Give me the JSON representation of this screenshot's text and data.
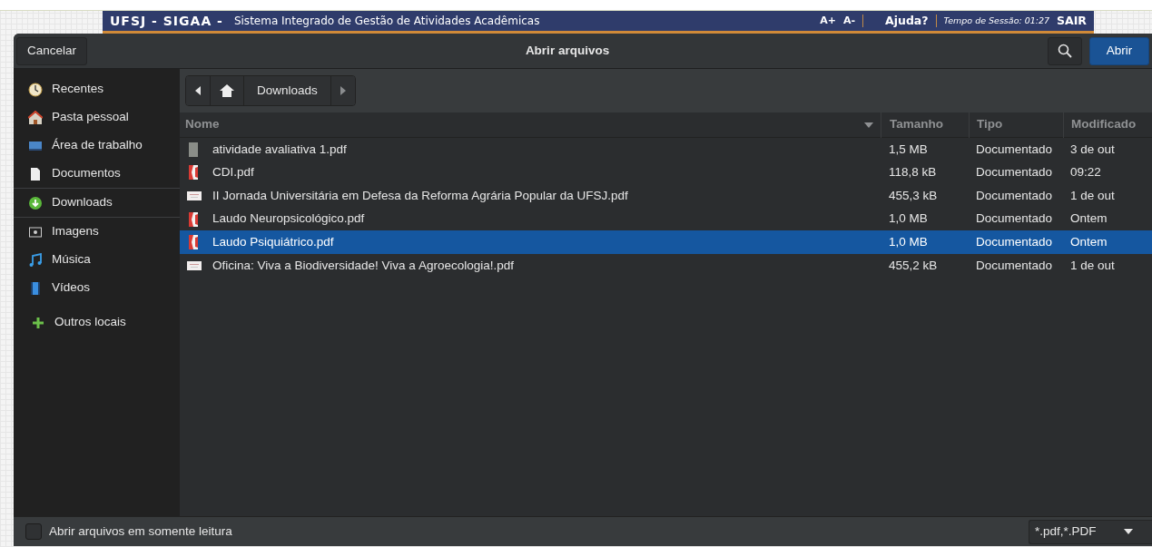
{
  "site_header": {
    "brand": "UFSJ - SIGAA -",
    "subtitle": "Sistema Integrado de Gestão de Atividades Acadêmicas",
    "font_up": "A+",
    "font_down": "A-",
    "help": "Ajuda?",
    "session": "Tempo de Sessão: 01:27",
    "logout": "SAIR"
  },
  "dialog": {
    "title": "Abrir arquivos",
    "cancel": "Cancelar",
    "open": "Abrir"
  },
  "sidebar": {
    "items": [
      {
        "kind": "place",
        "label": "Recentes"
      },
      {
        "kind": "place",
        "label": "Pasta pessoal"
      },
      {
        "kind": "place",
        "label": "Área de trabalho"
      },
      {
        "kind": "place",
        "label": "Documentos"
      },
      {
        "kind": "separator"
      },
      {
        "kind": "place",
        "label": "Downloads"
      },
      {
        "kind": "separator"
      },
      {
        "kind": "place",
        "label": "Imagens"
      },
      {
        "kind": "place",
        "label": "Música"
      },
      {
        "kind": "place",
        "label": "Vídeos"
      },
      {
        "kind": "other",
        "label": "Outros locais"
      }
    ]
  },
  "path_bar": {
    "segments": [
      "Downloads"
    ]
  },
  "table": {
    "columns": [
      "Nome",
      "Tamanho",
      "Tipo",
      "Modificado"
    ],
    "rows": [
      {
        "kind": "document",
        "name": "atividade avaliativa 1.pdf",
        "size": "1,5 MB",
        "type": "Documentado",
        "modified": "3 de out",
        "selected": false
      },
      {
        "kind": "pdf",
        "name": "CDI.pdf",
        "size": "118,8 kB",
        "type": "Documentado",
        "modified": "09:22",
        "selected": false
      },
      {
        "kind": "thumbnail",
        "name": "II Jornada Universitária em Defesa da Reforma Agrária Popular da UFSJ.pdf",
        "size": "455,3 kB",
        "type": "Documentado",
        "modified": "1 de out",
        "selected": false
      },
      {
        "kind": "pdf",
        "name": "Laudo Neuropsicológico.pdf",
        "size": "1,0 MB",
        "type": "Documentado",
        "modified": "Ontem",
        "selected": false
      },
      {
        "kind": "pdf",
        "name": "Laudo Psiquiátrico.pdf",
        "size": "1,0 MB",
        "type": "Documentado",
        "modified": "Ontem",
        "selected": true
      },
      {
        "kind": "thumbnail",
        "name": "Oficina: Viva a Biodiversidade! Viva a Agroecologia!.pdf",
        "size": "455,2 kB",
        "type": "Documentado",
        "modified": "1 de out",
        "selected": false
      }
    ]
  },
  "footer": {
    "read_only": {
      "label": "Abrir arquivos em somente leitura",
      "checked": false
    },
    "filter": "*.pdf,*.PDF"
  }
}
